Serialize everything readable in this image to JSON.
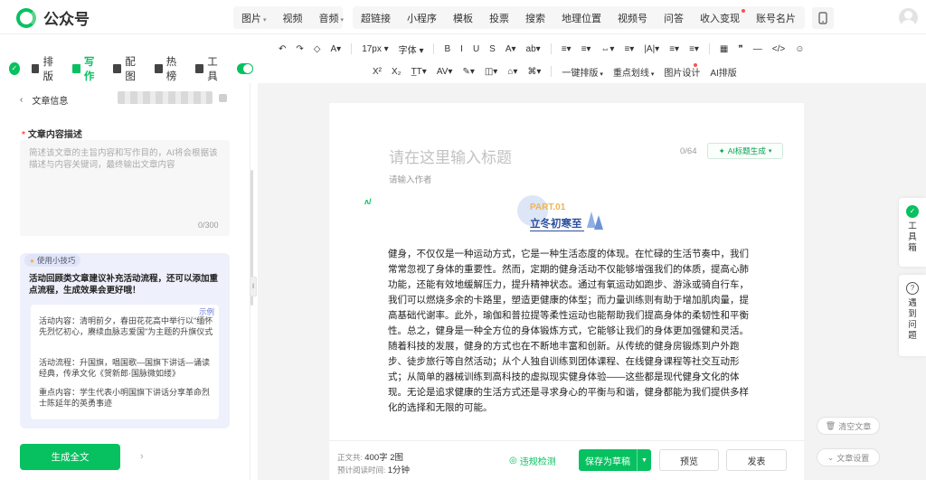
{
  "app": {
    "name": "公众号"
  },
  "topmenu": {
    "insert_items": [
      {
        "label": "图片",
        "caret": true
      },
      {
        "label": "视频",
        "caret": false
      },
      {
        "label": "音频",
        "caret": true
      }
    ],
    "main_items": [
      {
        "label": "超链接"
      },
      {
        "label": "小程序"
      },
      {
        "label": "模板"
      },
      {
        "label": "投票"
      },
      {
        "label": "搜索"
      },
      {
        "label": "地理位置"
      },
      {
        "label": "视频号"
      },
      {
        "label": "问答"
      },
      {
        "label": "收入变现",
        "dot": true
      },
      {
        "label": "账号名片"
      },
      {
        "label": "···"
      }
    ]
  },
  "left_tabs": [
    {
      "label": "排版",
      "icon": "layout-icon"
    },
    {
      "label": "写作",
      "icon": "ai-write-icon",
      "active": true
    },
    {
      "label": "配图",
      "icon": "image-icon"
    },
    {
      "label": "热榜",
      "icon": "fire-icon"
    },
    {
      "label": "工具",
      "icon": "tool-icon"
    }
  ],
  "toolbar": {
    "row1": [
      "↶",
      "↷",
      "◇",
      "A▾",
      "17px ▾",
      "字体 ▾",
      "B",
      "I",
      "U",
      "S",
      "A▾",
      "ab▾",
      "≡▾",
      "≡▾",
      "⇔▾",
      "≡▾",
      "|A|▾",
      "≡▾",
      "≡▾",
      "▦",
      "❞",
      "—",
      "</>",
      "☺"
    ],
    "row2": [
      "X²",
      "X₂",
      "T̲T▾",
      "AV▾",
      "✎▾",
      "◫▾",
      "⌂▾",
      "⌘▾"
    ],
    "row2_labeled": [
      {
        "label": "一键排版",
        "caret": true
      },
      {
        "label": "重点划线",
        "caret": true
      },
      {
        "label": "图片设计",
        "dot": true
      },
      {
        "label": "AI排版"
      }
    ]
  },
  "left_panel": {
    "header": "文章信息",
    "desc_label": "文章内容描述",
    "desc_placeholder": "简述该文章的主旨内容和写作目的，AI将会根据该描述与内容关键词，最终输出文章内容",
    "desc_count": "0/300",
    "tips_tag": "使用小技巧",
    "tips_title": "活动回顾类文章建议补充活动流程，还可以添加重点流程，生成效果会更好哦！",
    "tips_example": "示例",
    "tips": [
      "活动内容：清明前夕，春田花花高中举行以\"缅怀先烈忆初心，赓续血脉志爱国\"为主题的升旗仪式",
      "活动流程：升国旗，唱国歌—国旗下讲话—诵读经典，传承文化《贺新郎·国脉微如缕》",
      "重点内容：学生代表小明国旗下讲话分享革命烈士陈延年的英勇事迹"
    ],
    "generate_button": "生成全文"
  },
  "editor": {
    "title_placeholder": "请在这里输入标题",
    "title_count": "0/64",
    "ai_title_button": "AI标题生成",
    "author_placeholder": "请输入作者",
    "part_label": "PART.01",
    "part_title": "立冬初寒至",
    "body": "健身，不仅仅是一种运动方式，它是一种生活态度的体现。在忙碌的生活节奏中，我们常常忽视了身体的重要性。然而，定期的健身活动不仅能够增强我们的体质，提高心肺功能，还能有效地缓解压力，提升精神状态。通过有氧运动如跑步、游泳或骑自行车，我们可以燃烧多余的卡路里，塑造更健康的体型；而力量训练则有助于增加肌肉量，提高基础代谢率。此外，瑜伽和普拉提等柔性运动也能帮助我们提高身体的柔韧性和平衡性。总之，健身是一种全方位的身体锻炼方式，它能够让我们的身体更加强健和灵活。随着科技的发展，健身的方式也在不断地丰富和创新。从传统的健身房锻炼到户外跑步、徒步旅行等自然活动；从个人独自训练到团体课程、在线健身课程等社交互动形式；从简单的器械训练到高科技的虚拟现实健身体验——这些都是现代健身文化的体现。无论是追求健康的生活方式还是寻求身心的平衡与和谐，健身都能为我们提供多样化的选择和无限的可能。"
  },
  "bottom": {
    "stat1_label": "正文共:",
    "stat1_value": "400字 2图",
    "stat2_label": "预计阅读时间:",
    "stat2_value": "1分钟",
    "violation": "违规检测",
    "save": "保存为草稿",
    "preview": "预览",
    "publish": "发表"
  },
  "right": {
    "toolbox": "工具箱",
    "ask": "遇到问题",
    "clear": "清空文章",
    "settings": "文章设置"
  },
  "colors": {
    "brand": "#07c160",
    "part_blue": "#2b4f9e",
    "part_gold": "#f0b453"
  }
}
